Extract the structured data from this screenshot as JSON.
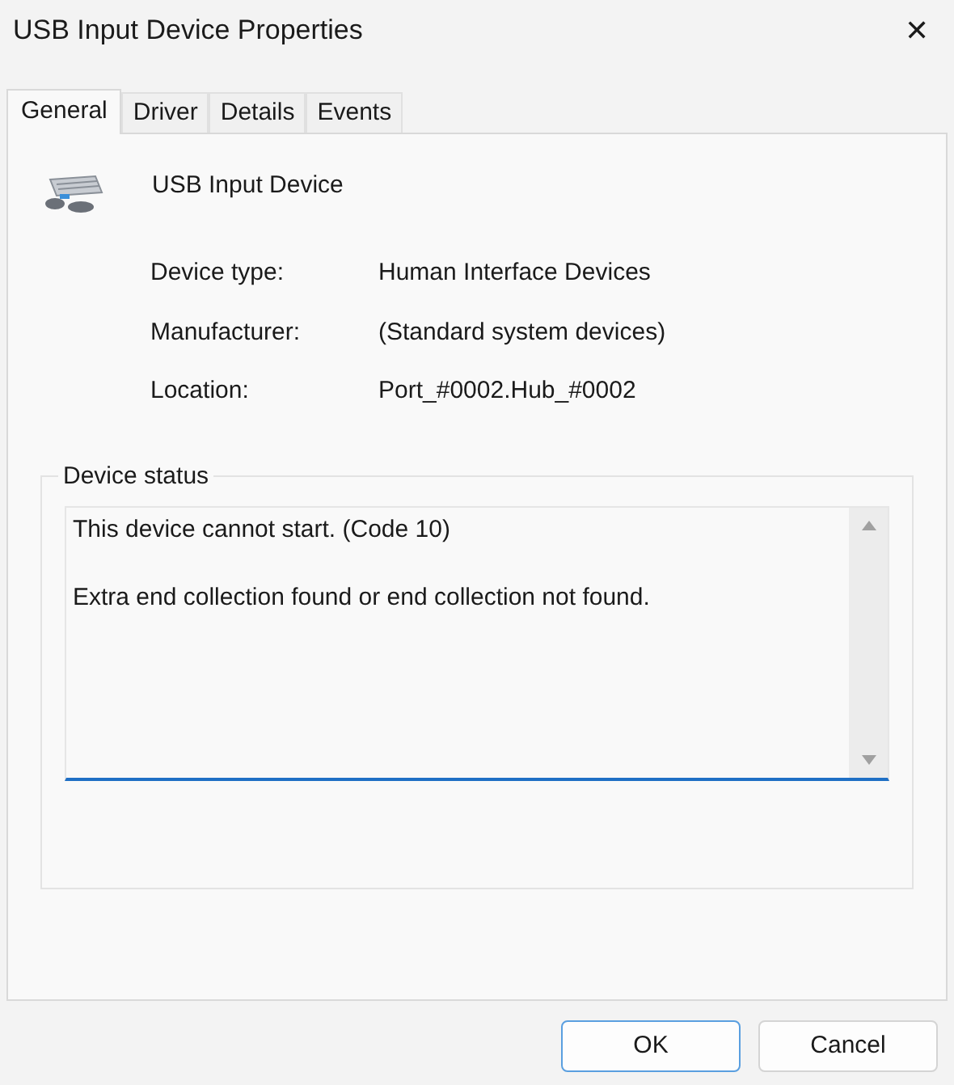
{
  "window": {
    "title": "USB Input Device Properties",
    "close": "✕"
  },
  "tabs": [
    {
      "label": "General",
      "selected": true
    },
    {
      "label": "Driver",
      "selected": false
    },
    {
      "label": "Details",
      "selected": false
    },
    {
      "label": "Events",
      "selected": false
    }
  ],
  "device": {
    "name": "USB Input Device"
  },
  "properties": [
    {
      "label": "Device type:",
      "value": "Human Interface Devices"
    },
    {
      "label": "Manufacturer:",
      "value": "(Standard system devices)"
    },
    {
      "label": "Location:",
      "value": "Port_#0002.Hub_#0002"
    }
  ],
  "status": {
    "label": "Device status",
    "lines": [
      "This device cannot start. (Code 10)",
      "Extra end collection found or end collection not found."
    ]
  },
  "buttons": [
    {
      "label": "OK",
      "default": true
    },
    {
      "label": "Cancel",
      "default": false
    }
  ]
}
